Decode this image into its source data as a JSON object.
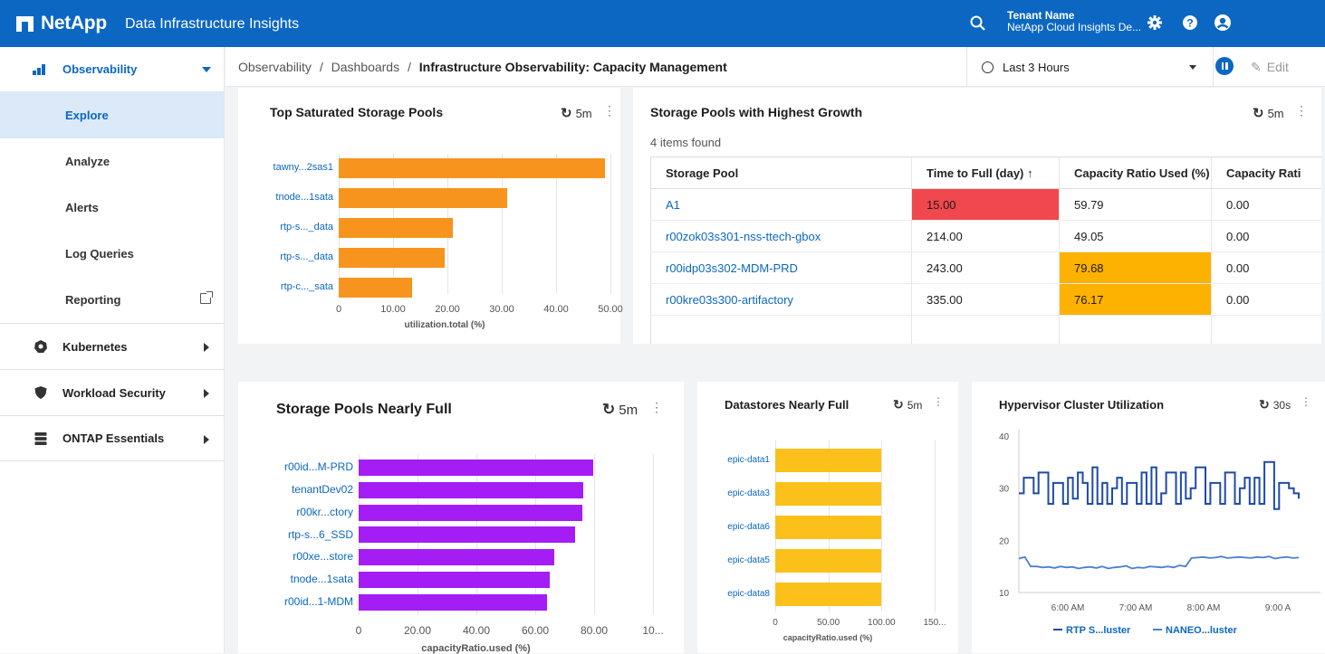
{
  "colors": {
    "brand": "#0b67c2",
    "bar_orange": "#f7941d",
    "bar_purple": "#a41df5",
    "bar_yellow": "#fbc11a",
    "line_dark": "#1e4aaa",
    "line_light": "#4a7fd0",
    "cell_red": "#f0484e",
    "cell_amber": "#fdb100"
  },
  "header": {
    "logo": "NetApp",
    "app_title": "Data Infrastructure Insights",
    "tenant_label": "Tenant Name",
    "tenant_value": "NetApp Cloud Insights De...",
    "icons": [
      "search-icon",
      "gear-icon",
      "help-icon",
      "user-icon"
    ]
  },
  "sidebar": {
    "section": "Observability",
    "items": [
      {
        "label": "Explore"
      },
      {
        "label": "Analyze"
      },
      {
        "label": "Alerts"
      },
      {
        "label": "Log Queries"
      },
      {
        "label": "Reporting"
      }
    ],
    "groups": [
      {
        "label": "Kubernetes",
        "icon": "kubernetes-icon"
      },
      {
        "label": "Workload Security",
        "icon": "shield-icon"
      },
      {
        "label": "ONTAP Essentials",
        "icon": "server-icon"
      }
    ]
  },
  "breadcrumb": {
    "part1": "Observability",
    "sep": "/",
    "part2": "Dashboards",
    "current": "Infrastructure Observability: Capacity Management"
  },
  "toolbar": {
    "time_range": "Last 3 Hours",
    "edit_label": "Edit"
  },
  "widgets": {
    "saturated": {
      "title": "Top Saturated Storage Pools",
      "refresh": "5m",
      "axis_title": "utilization.total (%)"
    },
    "growth": {
      "title": "Storage Pools with Highest Growth",
      "refresh": "5m",
      "count_text": "4 items found",
      "columns": [
        "Storage Pool",
        "Time to Full (day) ↑",
        "Capacity Ratio Used (%)",
        "Capacity Rati"
      ],
      "rows": [
        {
          "pool": "A1",
          "ttf": "15.00",
          "used": "59.79",
          "other": "0.00"
        },
        {
          "pool": "r00zok03s301-nss-ttech-gbox",
          "ttf": "214.00",
          "used": "49.05",
          "other": "0.00"
        },
        {
          "pool": "r00idp03s302-MDM-PRD",
          "ttf": "243.00",
          "used": "79.68",
          "other": "0.00"
        },
        {
          "pool": "r00kre03s300-artifactory",
          "ttf": "335.00",
          "used": "76.17",
          "other": "0.00"
        }
      ]
    },
    "nearly_full": {
      "title": "Storage Pools Nearly Full",
      "refresh": "5m",
      "axis_title": "capacityRatio.used (%)"
    },
    "datastores": {
      "title": "Datastores Nearly Full",
      "refresh": "5m",
      "axis_title": "capacityRatio.used (%)"
    },
    "hypervisor": {
      "title": "Hypervisor Cluster Utilization",
      "refresh": "30s"
    }
  },
  "chart_data": [
    {
      "type": "bar",
      "orientation": "horizontal",
      "title": "Top Saturated Storage Pools",
      "xlabel": "utilization.total (%)",
      "categories": [
        "tawny...2sas1",
        "tnode...1sata",
        "rtp-s..._data",
        "rtp-s..._data",
        "rtp-c..._sata"
      ],
      "values": [
        49,
        31,
        21,
        19.5,
        13.5
      ],
      "xlim": [
        0,
        60
      ],
      "ticks": [
        "0",
        "10.00",
        "20.00",
        "30.00",
        "40.00",
        "50.00",
        "60..."
      ],
      "grid": true
    },
    {
      "type": "bar",
      "orientation": "horizontal",
      "title": "Storage Pools Nearly Full",
      "xlabel": "capacityRatio.used (%)",
      "categories": [
        "r00id...M-PRD",
        "tenantDev02",
        "r00kr...ctory",
        "rtp-s...6_SSD",
        "r00xe...store",
        "tnode...1sata",
        "r00id...1-MDM"
      ],
      "values": [
        79.7,
        76.2,
        75.9,
        73.6,
        66.6,
        64.8,
        64.0
      ],
      "xlim": [
        0,
        100
      ],
      "ticks": [
        "0",
        "20.00",
        "40.00",
        "60.00",
        "80.00",
        "10..."
      ],
      "grid": true
    },
    {
      "type": "bar",
      "orientation": "horizontal",
      "title": "Datastores Nearly Full",
      "xlabel": "capacityRatio.used (%)",
      "categories": [
        "epic-data1",
        "epic-data3",
        "epic-data6",
        "epic-data5",
        "epic-data8"
      ],
      "values": [
        100,
        100,
        100,
        100,
        100
      ],
      "xlim": [
        0,
        150
      ],
      "ticks": [
        "0",
        "50.00",
        "100.00",
        "150..."
      ],
      "grid": true
    },
    {
      "type": "line",
      "title": "Hypervisor Cluster Utilization",
      "ylim": [
        10,
        40
      ],
      "yticks": [
        "40",
        "30",
        "20",
        "10"
      ],
      "xticks": [
        "6:00 AM",
        "7:00 AM",
        "8:00 AM",
        "9:00 A"
      ],
      "series": [
        {
          "name": "RTP S...luster",
          "values": [
            29,
            32,
            32,
            29,
            33,
            33,
            27,
            31,
            31,
            27,
            32,
            28,
            33,
            31,
            27,
            34,
            27,
            31,
            27,
            30,
            32,
            27,
            31,
            31,
            27,
            33,
            27,
            34,
            27,
            29,
            33,
            33,
            27,
            33,
            28,
            30,
            34,
            34,
            27,
            31,
            31,
            27,
            33,
            33,
            27,
            30,
            32,
            27,
            32,
            27,
            35,
            35,
            26,
            31,
            31,
            30,
            29,
            28
          ]
        },
        {
          "name": "NANEO...luster",
          "values": [
            16.5,
            16.8,
            15.0,
            15.0,
            14.8,
            14.9,
            14.7,
            15.0,
            14.8,
            14.9,
            14.6,
            14.8,
            14.9,
            14.7,
            15.0,
            14.6,
            14.8,
            14.9,
            15.1,
            14.6,
            14.8,
            14.7,
            15.0,
            14.9,
            14.8,
            15.0,
            14.8,
            15.2,
            15.0,
            16.6,
            16.7,
            16.8,
            16.6,
            16.7,
            16.9,
            16.6,
            16.7,
            16.8,
            16.7,
            16.6,
            16.8,
            16.7,
            16.9,
            16.5,
            16.7,
            16.8,
            16.6,
            16.7
          ]
        }
      ],
      "legend": "bottom"
    }
  ]
}
